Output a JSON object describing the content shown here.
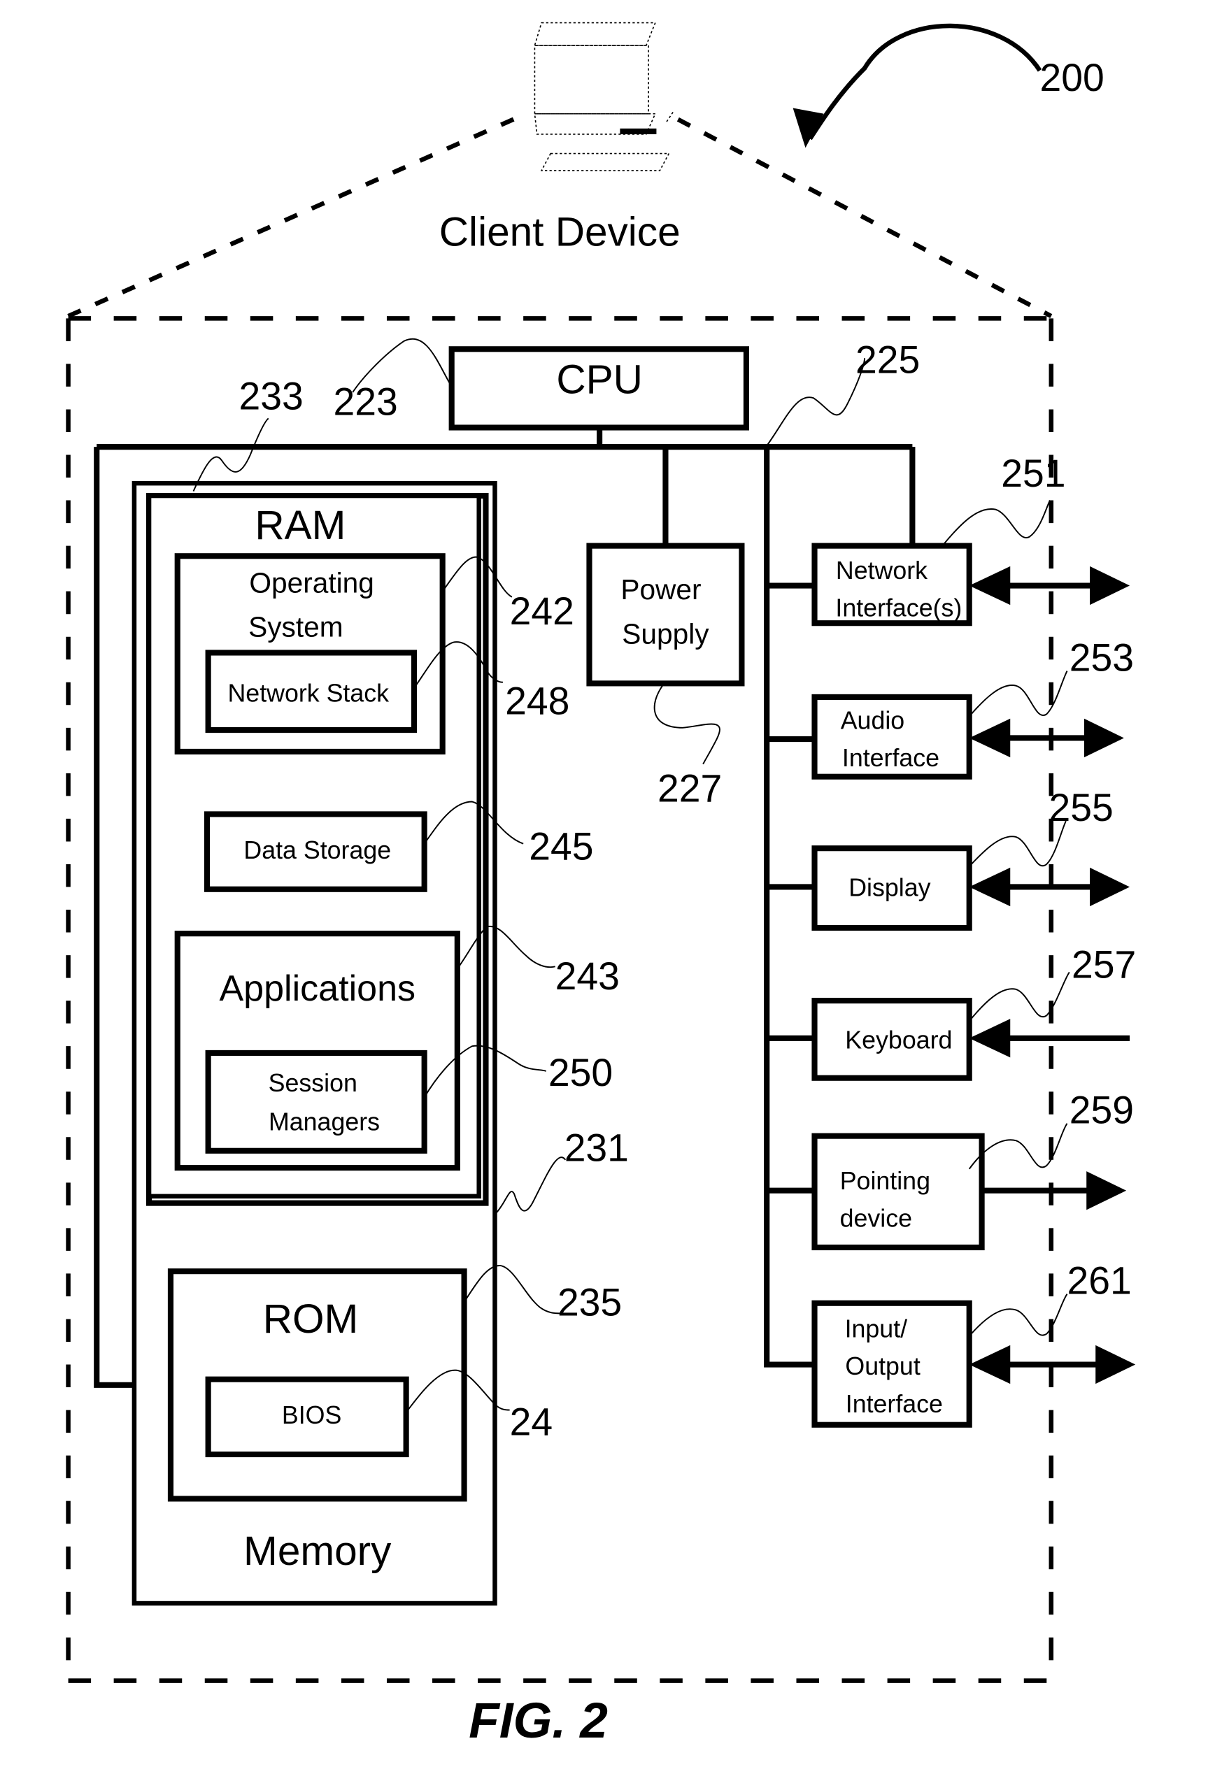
{
  "figure": {
    "caption": "FIG. 2",
    "reference_number": "200",
    "title": "Client Device"
  },
  "components": {
    "cpu": {
      "label": "CPU",
      "ref": "223"
    },
    "bus": {
      "ref": "225"
    },
    "power_supply": {
      "label_line1": "Power",
      "label_line2": "Supply",
      "ref": "227"
    },
    "memory": {
      "label": "Memory",
      "ref": "231"
    },
    "ram": {
      "label": "RAM",
      "ref": "233"
    },
    "operating_system": {
      "label_line1": "Operating",
      "label_line2": "System",
      "ref": "242"
    },
    "network_stack": {
      "label": "Network Stack",
      "ref": "248"
    },
    "data_storage": {
      "label": "Data Storage",
      "ref": "245"
    },
    "applications": {
      "label": "Applications",
      "ref": "243"
    },
    "session_managers": {
      "label_line1": "Session",
      "label_line2": "Managers",
      "ref": "250"
    },
    "rom": {
      "label": "ROM",
      "ref": "235"
    },
    "bios": {
      "label": "BIOS",
      "ref": "24"
    },
    "network_interface": {
      "label_line1": "Network",
      "label_line2": "Interface(s)",
      "ref": "251",
      "arrow": "bidirectional"
    },
    "audio_interface": {
      "label_line1": "Audio",
      "label_line2": "Interface",
      "ref": "253",
      "arrow": "bidirectional"
    },
    "display": {
      "label": "Display",
      "ref": "255",
      "arrow": "bidirectional"
    },
    "keyboard": {
      "label": "Keyboard",
      "ref": "257",
      "arrow": "inbound"
    },
    "pointing_device": {
      "label_line1": "Pointing",
      "label_line2": "device",
      "ref": "259",
      "arrow": "outbound"
    },
    "io_interface": {
      "label_line1": "Input/",
      "label_line2": "Output",
      "label_line3": "Interface",
      "ref": "261",
      "arrow": "bidirectional"
    }
  },
  "icons": {
    "computer": "computer-icon"
  }
}
